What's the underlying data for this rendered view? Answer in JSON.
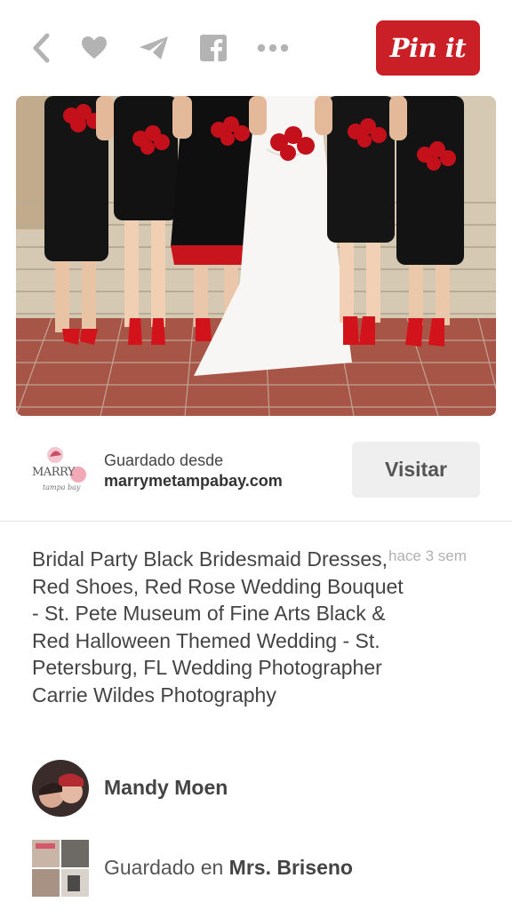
{
  "toolbar": {
    "icons": [
      "back-arrow-icon",
      "heart-icon",
      "send-icon",
      "facebook-icon",
      "more-icon"
    ],
    "pin_button": "Pin it",
    "accent": "#cb1f27"
  },
  "source": {
    "label": "Guardado desde",
    "domain": "marrymetampabay.com",
    "logo_text": "MARRY",
    "logo_subtext": "tampa bay",
    "visit_button": "Visitar"
  },
  "pin": {
    "description": "Bridal Party Black Bridesmaid Dresses, Red Shoes, Red Rose Wedding Bouquet - St. Pete Museum of Fine Arts Black & Red Halloween Themed Wedding - St. Petersburg, FL Wedding Photographer Carrie Wildes Photography",
    "time": "hace 3 sem"
  },
  "user": {
    "name": "Mandy Moen"
  },
  "board": {
    "prefix": "Guardado en",
    "name": "Mrs. Briseno"
  }
}
